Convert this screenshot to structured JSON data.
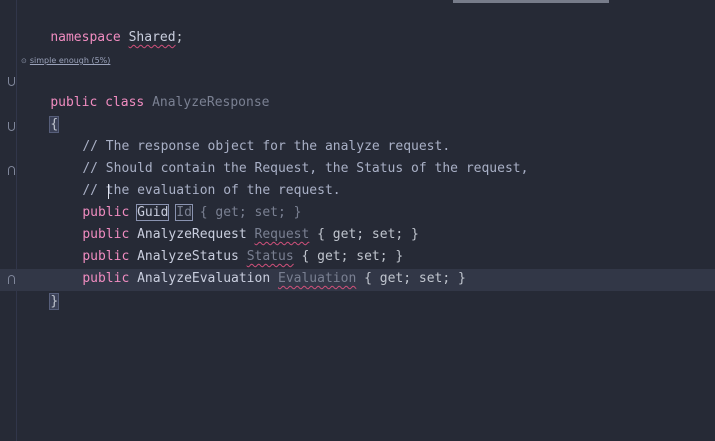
{
  "editor": {
    "hint": {
      "icon": "complexity-icon",
      "label": "simple enough (5%)"
    },
    "lines": {
      "ns_keyword": "namespace",
      "ns_name": "Shared",
      "ns_semicolon": ";",
      "class_public": "public",
      "class_keyword": "class",
      "class_name": "AnalyzeResponse",
      "open_brace": "{",
      "comment1": "// The response object for the analyze request.",
      "comment2": "// Should contain the Request, the Status of the request,",
      "comment3": "// the evaluation of the request.",
      "prop1_public": "public",
      "prop1_type": "Guid",
      "prop1_name": "Id",
      "prop1_accessors": "{ get; set; }",
      "prop2_public": "public",
      "prop2_type": "AnalyzeRequest",
      "prop2_name": "Request",
      "prop2_accessors": "{ get; set; }",
      "prop3_public": "public",
      "prop3_type": "AnalyzeStatus",
      "prop3_name": "Status",
      "prop3_accessors": "{ get; set; }",
      "prop4_public": "public",
      "prop4_type": "AnalyzeEvaluation",
      "prop4_name": "Evaluation",
      "prop4_accessors": "{ get; set; }",
      "close_brace": "}"
    }
  }
}
